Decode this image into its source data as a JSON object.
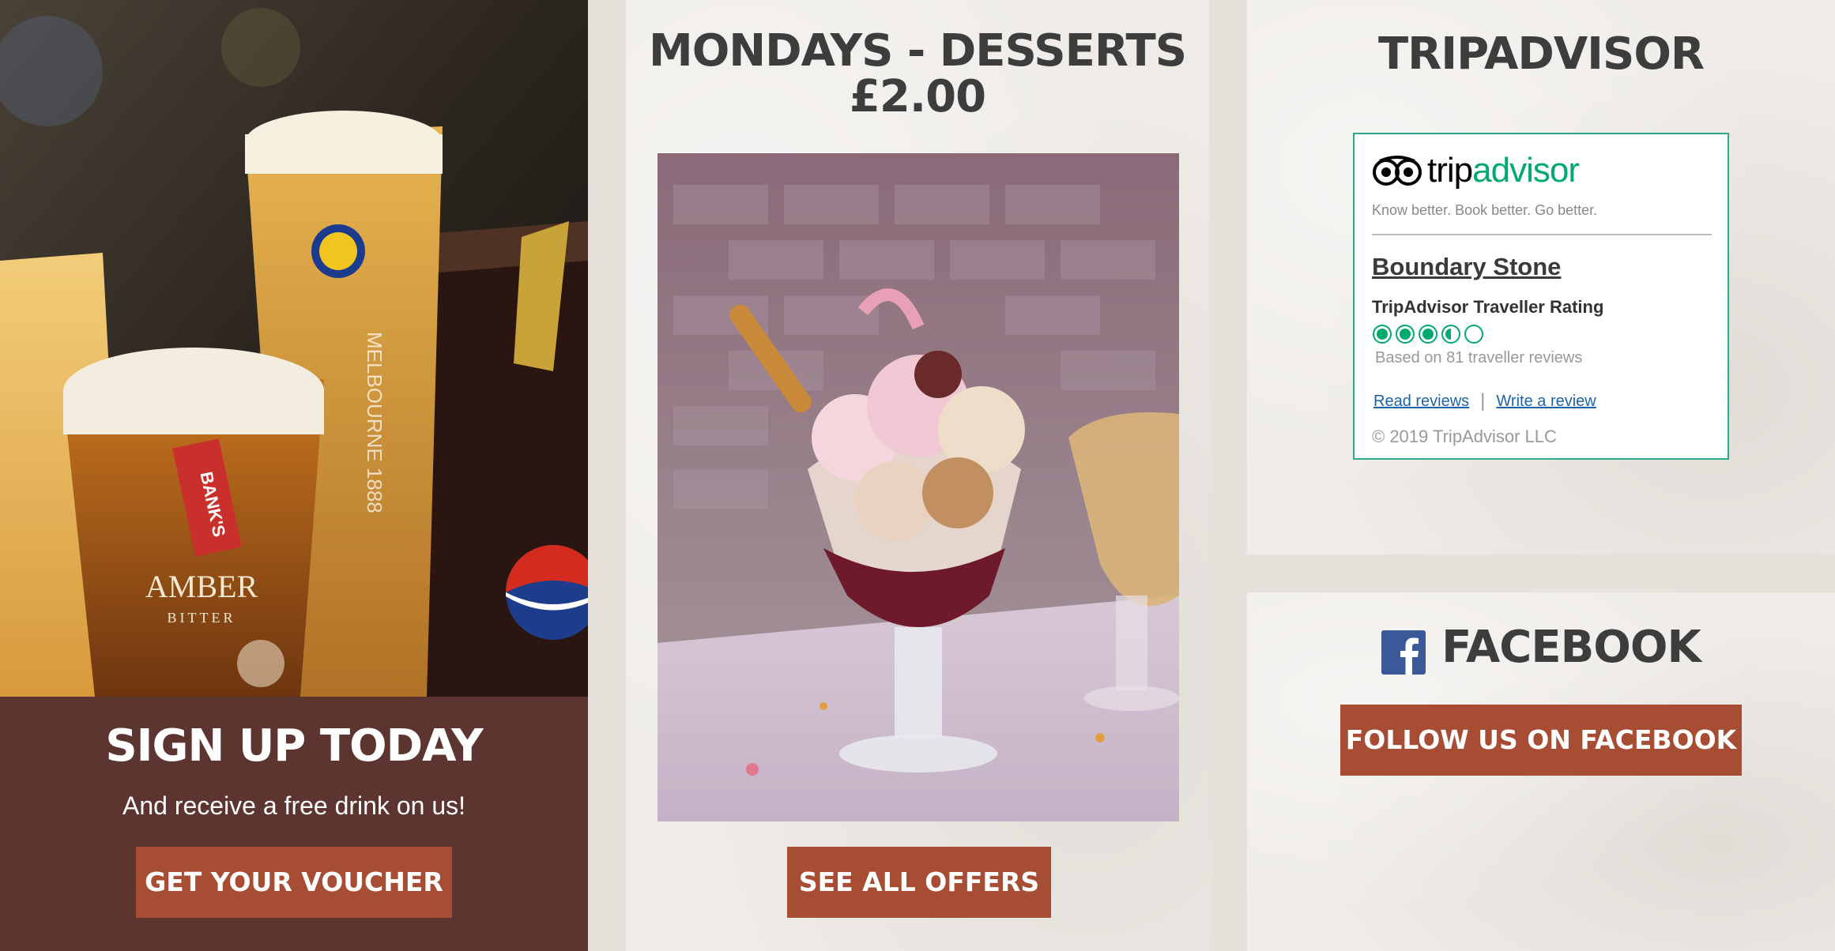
{
  "signup": {
    "title": "SIGN UP TODAY",
    "subtitle": "And receive a free drink on us!",
    "button": "GET YOUR VOUCHER"
  },
  "offers": {
    "title_line1": "MONDAYS - DESSERTS",
    "title_line2": "£2.00",
    "button": "SEE ALL OFFERS"
  },
  "tripadvisor": {
    "heading": "TRIPADVISOR",
    "logo_text_trip": "trip",
    "logo_text_advisor": "advisor",
    "tagline": "Know better. Book better. Go better.",
    "place_name": "Boundary Stone",
    "rating_label": "TripAdvisor Traveller Rating",
    "rating": 3.5,
    "rating_max": 5,
    "reviews_text": "Based on 81 traveller reviews",
    "read_reviews": "Read reviews",
    "write_review": "Write a review",
    "separator": "|",
    "copyright": "© 2019 TripAdvisor LLC"
  },
  "facebook": {
    "heading": "FACEBOOK",
    "button": "FOLLOW US ON FACEBOOK"
  },
  "drink_labels": {
    "pump_clip": "BANK'S",
    "beer_name": "AMBER",
    "beer_sub": "BITTER",
    "glass_text": "MELBOURNE 1888"
  },
  "colors": {
    "button": "#a74d33",
    "signup_box": "#5c3530",
    "heading": "#3d3d3d",
    "tripadvisor_green": "#00aa6c",
    "facebook_blue": "#3b5998"
  },
  "icons": [
    "tripadvisor-owl-icon",
    "rating-bubble-icon",
    "facebook-icon"
  ]
}
